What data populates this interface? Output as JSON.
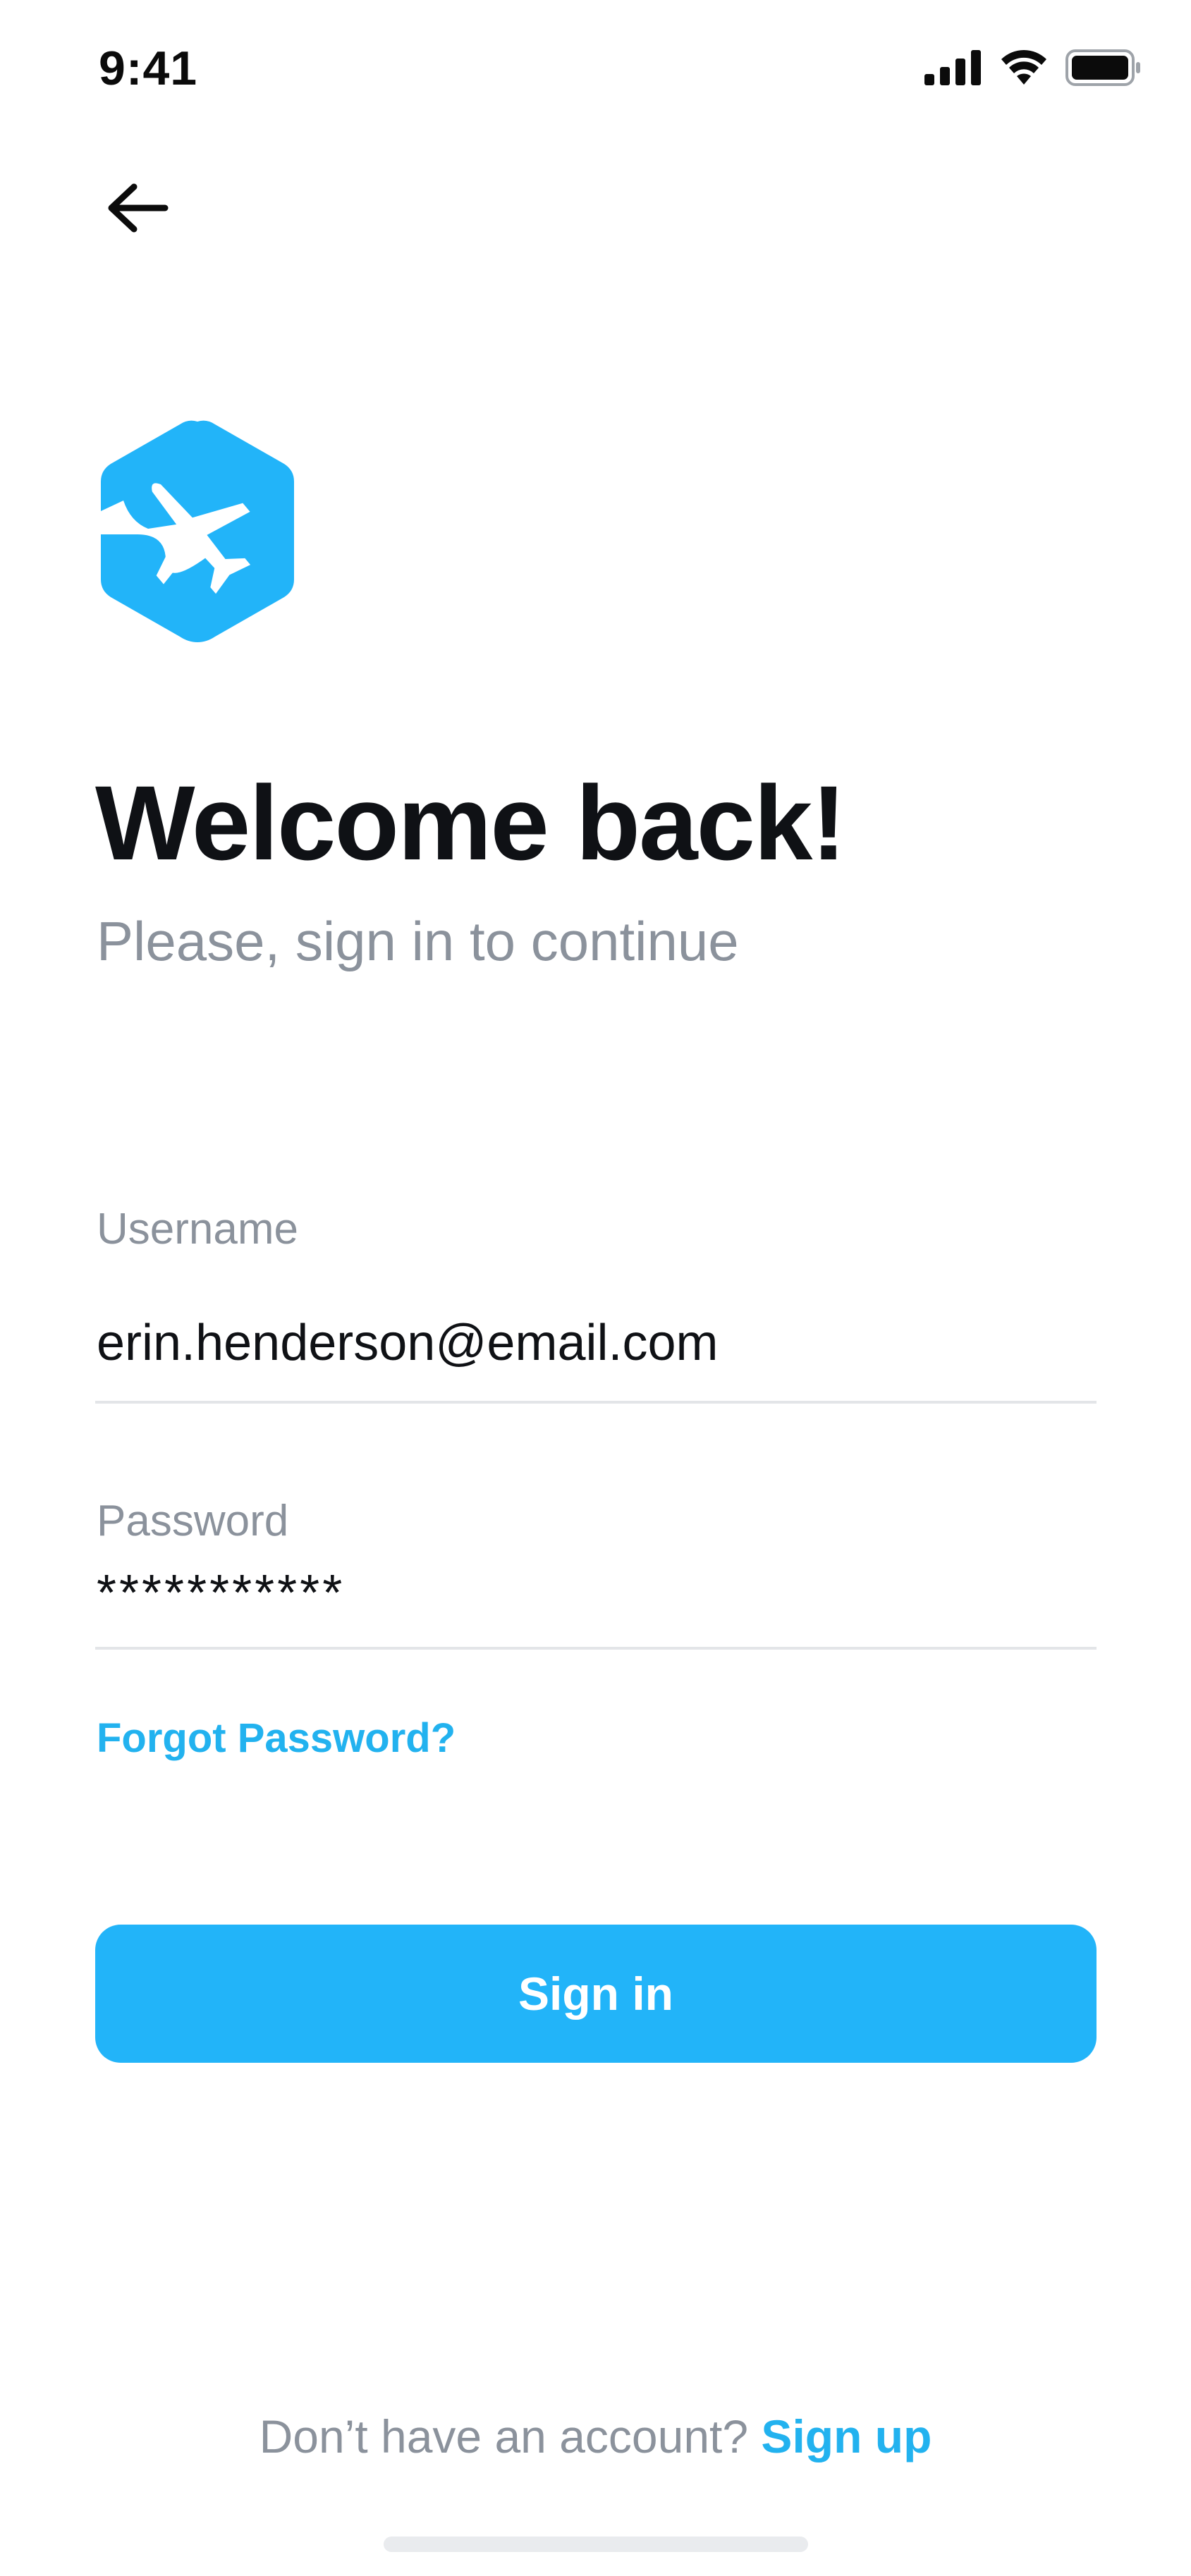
{
  "status_bar": {
    "time": "9:41",
    "icons": [
      "signal-icon",
      "wifi-icon",
      "battery-icon"
    ]
  },
  "nav": {
    "back_icon": "arrow-left-icon"
  },
  "brand": {
    "logo_icon": "airplane-hexagon-icon",
    "accent_color": "#22b4f9"
  },
  "header": {
    "title": "Welcome back!",
    "subtitle": "Please, sign in to continue"
  },
  "form": {
    "username": {
      "label": "Username",
      "value": "erin.henderson@email.com"
    },
    "password": {
      "label": "Password",
      "value": "***********"
    },
    "forgot_label": "Forgot Password?",
    "submit_label": "Sign in"
  },
  "footer": {
    "prompt": "Don’t have an account?",
    "signup_label": "Sign up"
  }
}
